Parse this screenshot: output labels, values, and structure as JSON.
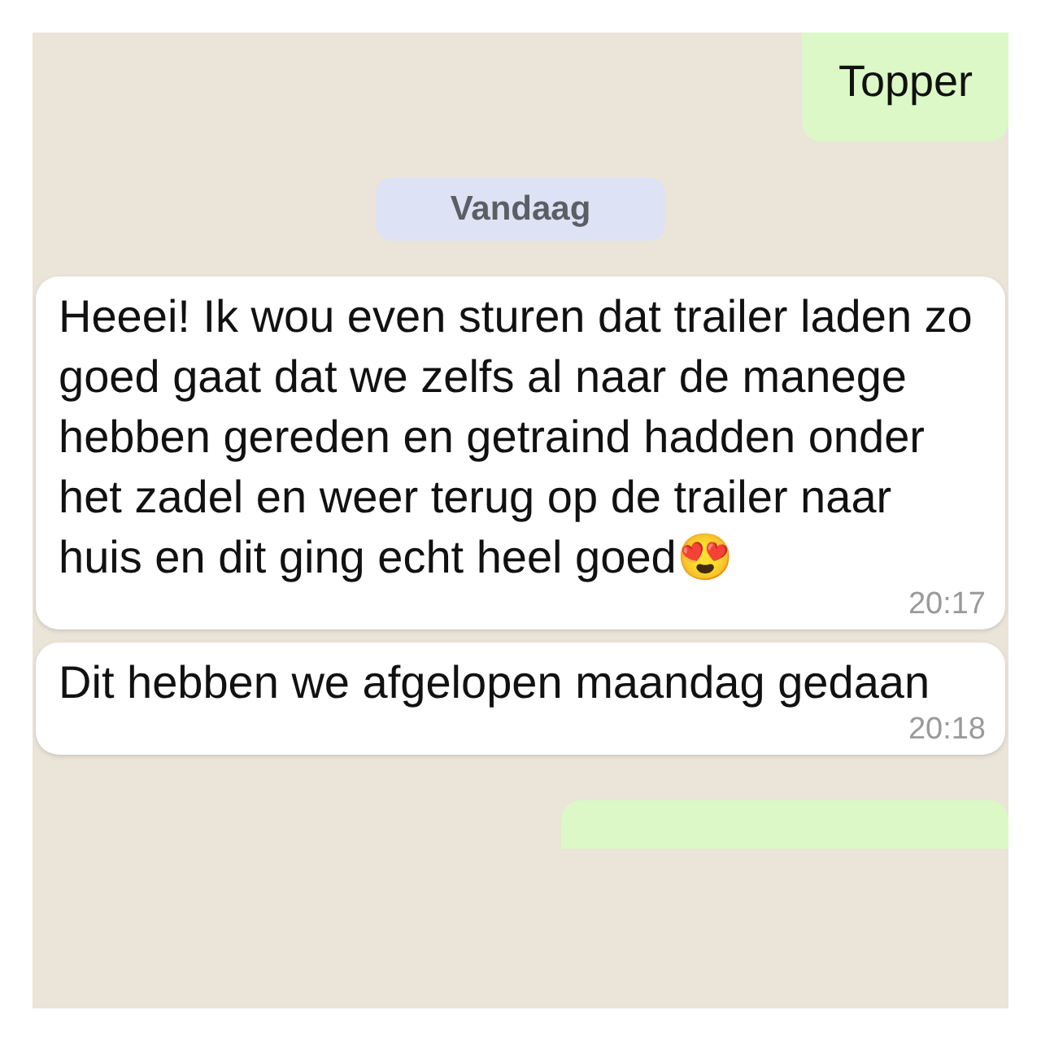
{
  "messages": [
    {
      "kind": "outgoing",
      "text": "Topper"
    },
    {
      "kind": "date",
      "text": "Vandaag"
    },
    {
      "kind": "incoming",
      "text": "Heeei! Ik wou even sturen dat trailer laden zo goed gaat dat we zelfs al naar de manege hebben gereden en getraind hadden onder het zadel en weer terug op de trailer naar huis en dit ging echt heel goed😍",
      "time": "20:17"
    },
    {
      "kind": "incoming",
      "text": "Dit hebben we afgelopen maandag gedaan",
      "time": "20:18"
    },
    {
      "kind": "outgoing"
    }
  ]
}
